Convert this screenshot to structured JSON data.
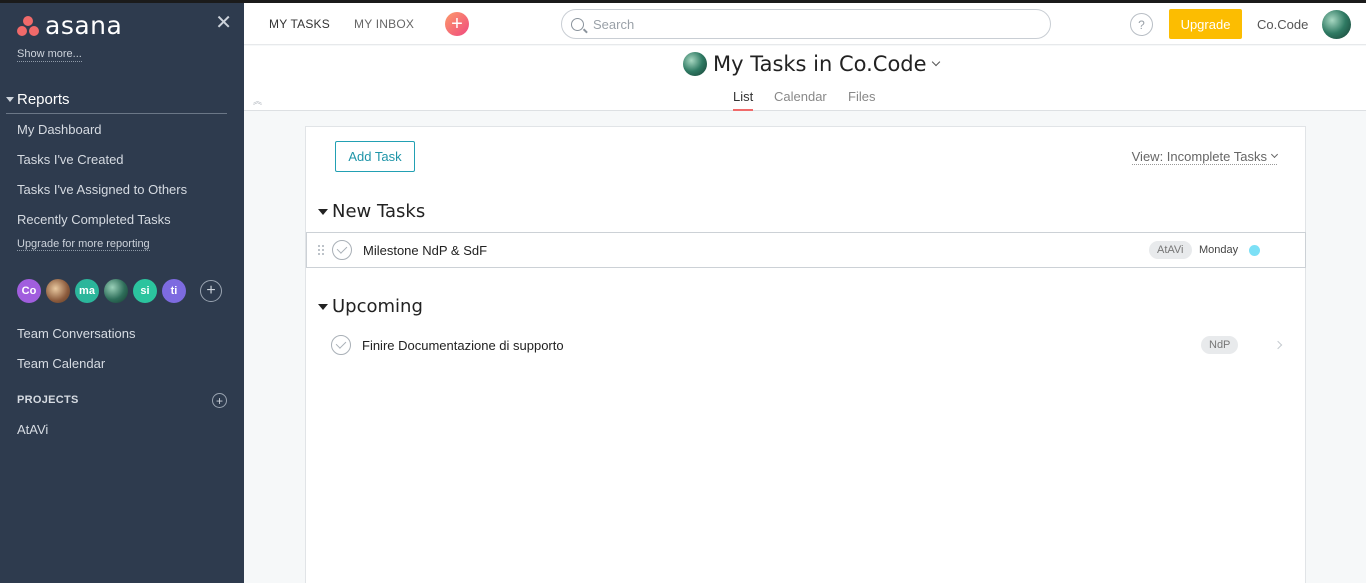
{
  "app": {
    "brand": "asana"
  },
  "sidebar": {
    "show_more": "Show more...",
    "reports": {
      "title": "Reports",
      "items": [
        {
          "label": "My Dashboard"
        },
        {
          "label": "Tasks I've Created"
        },
        {
          "label": "Tasks I've Assigned to Others"
        },
        {
          "label": "Recently Completed Tasks"
        }
      ],
      "upgrade_link": "Upgrade for more reporting"
    },
    "members": [
      {
        "initials": "Co",
        "color": "#a15ede"
      },
      {
        "initials": "",
        "color": "photo"
      },
      {
        "initials": "ma",
        "color": "#2bb69b"
      },
      {
        "initials": "",
        "color": "photo"
      },
      {
        "initials": "si",
        "color": "#2bc49e"
      },
      {
        "initials": "ti",
        "color": "#7d6be0"
      }
    ],
    "team_links": [
      {
        "label": "Team Conversations"
      },
      {
        "label": "Team Calendar"
      }
    ],
    "projects": {
      "label": "PROJECTS",
      "items": [
        {
          "label": "AtAVi"
        }
      ]
    }
  },
  "topbar": {
    "tabs": [
      {
        "label": "MY TASKS"
      },
      {
        "label": "MY INBOX"
      }
    ],
    "search_placeholder": "Search",
    "help": "?",
    "upgrade": "Upgrade",
    "org": "Co.Code",
    "accent_color": "#fcbd01"
  },
  "header": {
    "title": "My Tasks in Co.Code",
    "views": [
      {
        "label": "List",
        "active": true
      },
      {
        "label": "Calendar",
        "active": false
      },
      {
        "label": "Files",
        "active": false
      }
    ]
  },
  "main": {
    "add_task": "Add Task",
    "view_filter": "View: Incomplete Tasks",
    "sections": [
      {
        "title": "New Tasks",
        "tasks": [
          {
            "name": "Milestone NdP & SdF",
            "tag": "AtAVi",
            "due": "Monday"
          }
        ]
      },
      {
        "title": "Upcoming",
        "tasks": [
          {
            "name": "Finire Documentazione di supporto",
            "tag": "NdP",
            "due": ""
          }
        ]
      }
    ]
  }
}
